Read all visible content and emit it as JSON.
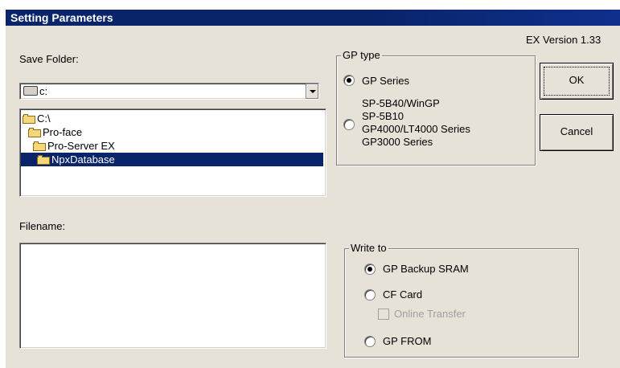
{
  "window": {
    "title": "Setting Parameters",
    "version": "EX Version 1.33"
  },
  "save_folder": {
    "label": "Save Folder:",
    "drive": "c:",
    "tree": [
      {
        "label": "C:\\"
      },
      {
        "label": "Pro-face"
      },
      {
        "label": "Pro-Server EX"
      },
      {
        "label": "NpxDatabase"
      }
    ]
  },
  "filename": {
    "label": "Filename:",
    "value": ""
  },
  "gp_type": {
    "legend": "GP type",
    "option1": "GP Series",
    "option2_lines": [
      "SP-5B40/WinGP",
      "SP-5B10",
      "GP4000/LT4000 Series",
      "GP3000 Series"
    ]
  },
  "buttons": {
    "ok": "OK",
    "cancel": "Cancel"
  },
  "write_to": {
    "legend": "Write to",
    "opt1": "GP Backup SRAM",
    "opt2": "CF Card",
    "online": "Online Transfer",
    "opt3": "GP FROM"
  }
}
